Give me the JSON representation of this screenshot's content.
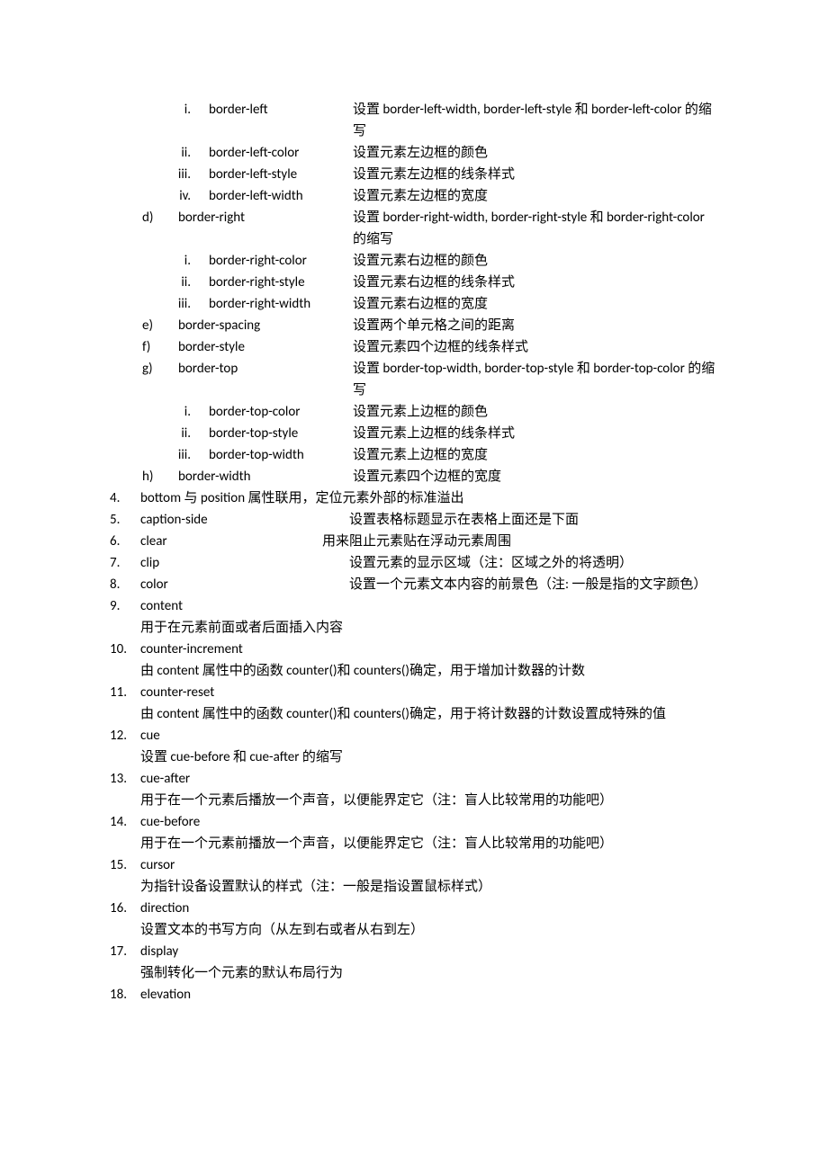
{
  "border_left_items": [
    {
      "roman": "i.",
      "term": "border-left",
      "desc": "设置 border-left-width, border-left-style  和 border-left-color 的缩写",
      "wrap": true
    },
    {
      "roman": "ii.",
      "term": "border-left-color",
      "desc": "设置元素左边框的颜色"
    },
    {
      "roman": "iii.",
      "term": "border-left-style",
      "desc": "设置元素左边框的线条样式"
    },
    {
      "roman": "iv.",
      "term": "border-left-width",
      "desc": "设置元素左边框的宽度"
    }
  ],
  "border_right": {
    "letter": "d)",
    "term": "border-right",
    "desc": "设置 border-right-width, border-right-style  和 border-right-color 的缩写"
  },
  "border_right_items": [
    {
      "roman": "i.",
      "term": "border-right-color",
      "desc": "设置元素右边框的颜色"
    },
    {
      "roman": "ii.",
      "term": "border-right-style",
      "desc": "设置元素右边框的线条样式"
    },
    {
      "roman": "iii.",
      "term": "border-right-width",
      "desc": "设置元素右边框的宽度"
    }
  ],
  "border_mid": [
    {
      "letter": "e)",
      "term": "border-spacing",
      "desc": "设置两个单元格之间的距离"
    },
    {
      "letter": "f)",
      "term": "border-style",
      "desc": "设置元素四个边框的线条样式"
    }
  ],
  "border_top": {
    "letter": "g)",
    "term": "border-top",
    "desc": "设置 border-top-width, border-top-style  和 border-top-color 的缩写"
  },
  "border_top_items": [
    {
      "roman": "i.",
      "term": "border-top-color",
      "desc": "设置元素上边框的颜色"
    },
    {
      "roman": "ii.",
      "term": "border-top-style",
      "desc": "设置元素上边框的线条样式"
    },
    {
      "roman": "iii.",
      "term": "border-top-width",
      "desc": "设置元素上边框的宽度"
    }
  ],
  "border_width": {
    "letter": "h)",
    "term": "border-width",
    "desc": "设置元素四个边框的宽度"
  },
  "num4": {
    "n": "4.",
    "text": "bottom  与 position 属性联用，定位元素外部的标准溢出"
  },
  "num5": {
    "n": "5.",
    "term": "caption-side",
    "desc": "设置表格标题显示在表格上面还是下面"
  },
  "num6": {
    "n": "6.",
    "term": "clear",
    "desc": "用来阻止元素贴在浮动元素周围"
  },
  "num7": {
    "n": "7.",
    "term": "clip",
    "desc": "设置元素的显示区域（注：区域之外的将透明）"
  },
  "num8": {
    "n": "8.",
    "term": "color",
    "desc": "设置一个元素文本内容的前景色（注: 一般是指的文字颜色）"
  },
  "num9": {
    "n": "9.",
    "term": "content",
    "desc": "用于在元素前面或者后面插入内容"
  },
  "num10": {
    "n": "10.",
    "term": "counter-increment",
    "desc": "由 content 属性中的函数  counter()和 counters()确定，用于增加计数器的计数"
  },
  "num11": {
    "n": "11.",
    "term": "counter-reset",
    "desc": "由 content 属性中的函数  counter()和 counters()确定，用于将计数器的计数设置成特殊的值"
  },
  "num12": {
    "n": "12.",
    "term": "cue",
    "desc": "设置  cue-before  和  cue-after 的缩写"
  },
  "num13": {
    "n": "13.",
    "term": "cue-after",
    "desc": "用于在一个元素后播放一个声音，以便能界定它（注：盲人比较常用的功能吧）"
  },
  "num14": {
    "n": "14.",
    "term": "cue-before",
    "desc": "用于在一个元素前播放一个声音，以便能界定它（注：盲人比较常用的功能吧）"
  },
  "num15": {
    "n": "15.",
    "term": "cursor",
    "desc": "为指针设备设置默认的样式（注：一般是指设置鼠标样式）"
  },
  "num16": {
    "n": "16.",
    "term": "direction",
    "desc": "设置文本的书写方向（从左到右或者从右到左）"
  },
  "num17": {
    "n": "17.",
    "term": "display",
    "desc": "强制转化一个元素的默认布局行为"
  },
  "num18": {
    "n": "18.",
    "term": "elevation"
  }
}
